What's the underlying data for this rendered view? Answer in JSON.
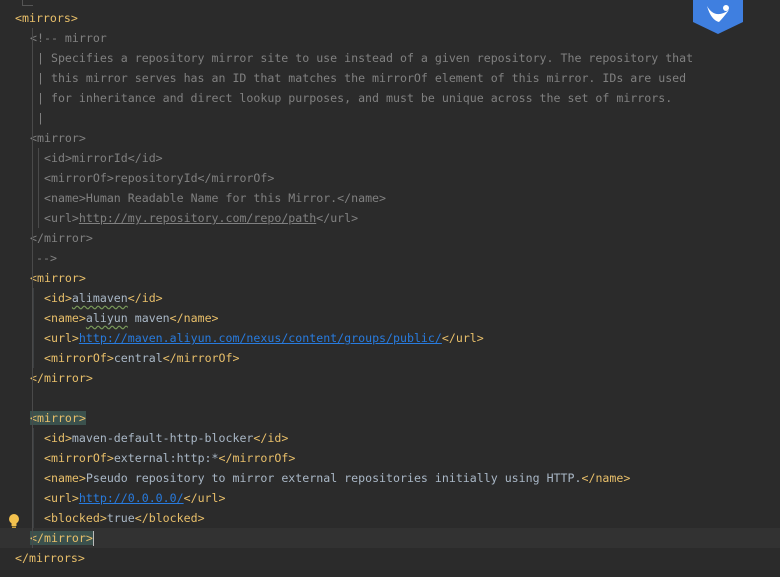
{
  "lines": [
    {
      "tokens": [
        [
          "tag",
          "<mirrors>"
        ]
      ]
    },
    {
      "tokens": [
        [
          "cmt",
          "<!-- mirror"
        ]
      ]
    },
    {
      "tokens": [
        [
          "cmt",
          "| Specifies a repository mirror site to use instead of a given repository. The repository that"
        ]
      ]
    },
    {
      "tokens": [
        [
          "cmt",
          "| this mirror serves has an ID that matches the mirrorOf element of this mirror. IDs are used"
        ]
      ]
    },
    {
      "tokens": [
        [
          "cmt",
          "| for inheritance and direct lookup purposes, and must be unique across the set of mirrors."
        ]
      ]
    },
    {
      "tokens": [
        [
          "cmt",
          "|"
        ]
      ]
    },
    {
      "tokens": [
        [
          "cmt",
          "<mirror>"
        ]
      ]
    },
    {
      "tokens": [
        [
          "cmt",
          "<id>mirrorId</id>"
        ]
      ]
    },
    {
      "tokens": [
        [
          "cmt",
          "<mirrorOf>repositoryId</mirrorOf>"
        ]
      ]
    },
    {
      "tokens": [
        [
          "cmt",
          "<name>Human Readable Name for this Mirror.</name>"
        ]
      ]
    },
    {
      "tokens": [
        [
          "cmt",
          "<url>"
        ],
        [
          "cmtlink",
          "http://my.repository.com/repo/path"
        ],
        [
          "cmt",
          "</url>"
        ]
      ]
    },
    {
      "tokens": [
        [
          "cmt",
          "</mirror>"
        ]
      ]
    },
    {
      "tokens": [
        [
          "cmt",
          "-->"
        ]
      ]
    },
    {
      "tokens": [
        [
          "tag",
          "<mirror>"
        ]
      ]
    },
    {
      "tokens": [
        [
          "tag",
          "<id>"
        ],
        [
          "sq",
          "alimaven"
        ],
        [
          "tag",
          "</id>"
        ]
      ]
    },
    {
      "tokens": [
        [
          "tag",
          "<name>"
        ],
        [
          "sq",
          "aliyun"
        ],
        [
          "txt",
          " maven"
        ],
        [
          "tag",
          "</name>"
        ]
      ]
    },
    {
      "tokens": [
        [
          "tag",
          "<url>"
        ],
        [
          "link",
          "http://maven.aliyun.com/nexus/content/groups/public/"
        ],
        [
          "tag",
          "</url>"
        ]
      ]
    },
    {
      "tokens": [
        [
          "tag",
          "<mirrorOf>"
        ],
        [
          "txt",
          "central"
        ],
        [
          "tag",
          "</mirrorOf>"
        ]
      ]
    },
    {
      "tokens": [
        [
          "tag",
          "</mirror>"
        ]
      ]
    },
    {
      "tokens": []
    },
    {
      "tokens": [
        [
          "match",
          "<mirror>"
        ]
      ]
    },
    {
      "tokens": [
        [
          "tag",
          "<id>"
        ],
        [
          "txt",
          "maven-default-http-blocker"
        ],
        [
          "tag",
          "</id>"
        ]
      ]
    },
    {
      "tokens": [
        [
          "tag",
          "<mirrorOf>"
        ],
        [
          "txt",
          "external:http:*"
        ],
        [
          "tag",
          "</mirrorOf>"
        ]
      ]
    },
    {
      "tokens": [
        [
          "tag",
          "<name>"
        ],
        [
          "txt",
          "Pseudo repository to mirror external repositories initially using HTTP."
        ],
        [
          "tag",
          "</name>"
        ]
      ]
    },
    {
      "tokens": [
        [
          "tag",
          "<url>"
        ],
        [
          "link",
          "http://0.0.0.0/"
        ],
        [
          "tag",
          "</url>"
        ]
      ]
    },
    {
      "tokens": [
        [
          "tag",
          "<blocked>"
        ],
        [
          "txt",
          "true"
        ],
        [
          "tag",
          "</blocked>"
        ]
      ]
    },
    {
      "tokens": [
        [
          "match",
          "</mirror>"
        ],
        [
          "caret",
          ""
        ]
      ]
    },
    {
      "tokens": [
        [
          "tag",
          "</mirrors>"
        ]
      ]
    }
  ],
  "icons": {
    "gutter": "lightbulb-icon",
    "badge": "plugin-badge-icon"
  },
  "colors": {
    "background": "#2b2b2b",
    "tag": "#e8bf6a",
    "text": "#a9b7c6",
    "comment": "#808080",
    "link": "#287bde",
    "badge": "#3f7fe0",
    "bulb": "#f2c14e"
  }
}
